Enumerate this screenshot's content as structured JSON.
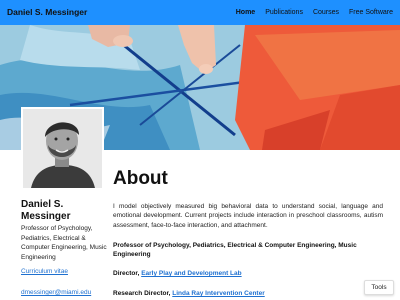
{
  "nav": {
    "brand": "Daniel S. Messinger",
    "links": [
      "Home",
      "Publications",
      "Courses",
      "Free Software"
    ],
    "active": "Home"
  },
  "profile": {
    "name": "Daniel S. Messinger",
    "role": "Professor of Psychology, Pediatrics, Electrical & Computer Engineering, Music Engineering",
    "cv_label": "Curriculum vitae",
    "email": "dmessinger@miami.edu"
  },
  "about": {
    "title": "About",
    "body": "I model objectively measured big behavioral data to understand social, language and emotional development. Current projects include interaction in preschool classrooms, autism assessment, face-to-face interaction, and attachment.",
    "position": "Professor of Psychology, Pediatrics, Electrical & Computer Engineering, Music Engineering",
    "director_label": "Director,",
    "director_link": "Early Play and Development Lab",
    "research_label": "Research Director,",
    "research_link": "Linda Ray Intervention Center"
  },
  "tools_label": "Tools",
  "colors": {
    "navbar": "#1e90ff",
    "link": "#1e70d0"
  }
}
